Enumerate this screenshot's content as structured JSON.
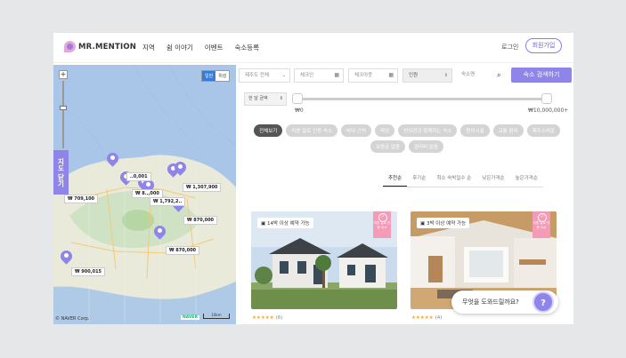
{
  "header": {
    "logo_text": "MR.MENTION",
    "nav": [
      "지역",
      "쉼 이야기",
      "이벤트",
      "숙소등록"
    ],
    "login": "로그인",
    "signup": "회원가입"
  },
  "map": {
    "toggle": [
      "일반",
      "위성"
    ],
    "zoom_in": "+",
    "zoom_out": "−",
    "fold_label": "지도 닫기",
    "prices": [
      "₩ 709,100",
      "₩ 1,307,900",
      "₩ 8..,000",
      "₩ 1,792,2..",
      "₩ 870,000",
      "₩ 870,000",
      "₩ 900,015",
      "..0,001"
    ],
    "copyright": "© NAVER Corp.",
    "naver": "NAVER",
    "scale": "10km"
  },
  "filters": {
    "region": "제주도 전체",
    "checkin": "체크인",
    "checkout": "체크아웃",
    "guests": "인원",
    "lodging_placeholder": "숙소명",
    "search_button": "숙소 검색하기",
    "price_period": "한 달 금액",
    "range_min": "₩0",
    "range_max": "₩10,000,000+"
  },
  "chips": [
    "전체보기",
    "미쁜 말로 인증 숙소",
    "바다 근처",
    "마당",
    "반려견과 함께하는 숙소",
    "편의시설",
    "교통 편리",
    "제주스러운",
    "보증금 없음",
    "관리비 없음"
  ],
  "sorts": [
    "추천순",
    "후기순",
    "최소 숙박일수 순",
    "낮은가격순",
    "높은가격순"
  ],
  "cards": [
    {
      "badge": "14박 이상 예약 가능",
      "ribbon": "미쁜 말로 인증 숙소",
      "stars": "★★★★★",
      "count": "(6)"
    },
    {
      "badge": "3박 이상 예약 가능",
      "ribbon": "미쁜 말로 인증 숙소",
      "stars": "★★★★★",
      "count": "(4)"
    }
  ],
  "chat": {
    "text": "무엇을 도와드릴까요?",
    "button": "?"
  },
  "colors": {
    "accent": "#8f84e8",
    "ribbon": "#f39bb7",
    "sea": "#a9c6e8"
  }
}
